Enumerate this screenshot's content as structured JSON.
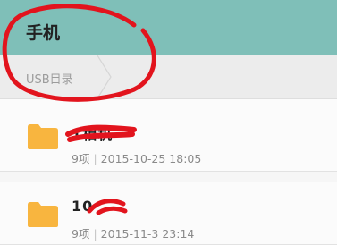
{
  "header": {
    "title": "手机"
  },
  "breadcrumb": {
    "items": [
      "USB目录"
    ]
  },
  "files": [
    {
      "name": "1相机",
      "count": "9项",
      "date": "2015-10-25 18:05",
      "icon": "folder-icon"
    },
    {
      "name": "10",
      "count": "9项",
      "date": "2015-11-3 23:14",
      "icon": "folder-icon"
    }
  ],
  "colors": {
    "header_bg": "#7fbfb8",
    "folder": "#f8b53f",
    "annotation": "#e2141d"
  }
}
